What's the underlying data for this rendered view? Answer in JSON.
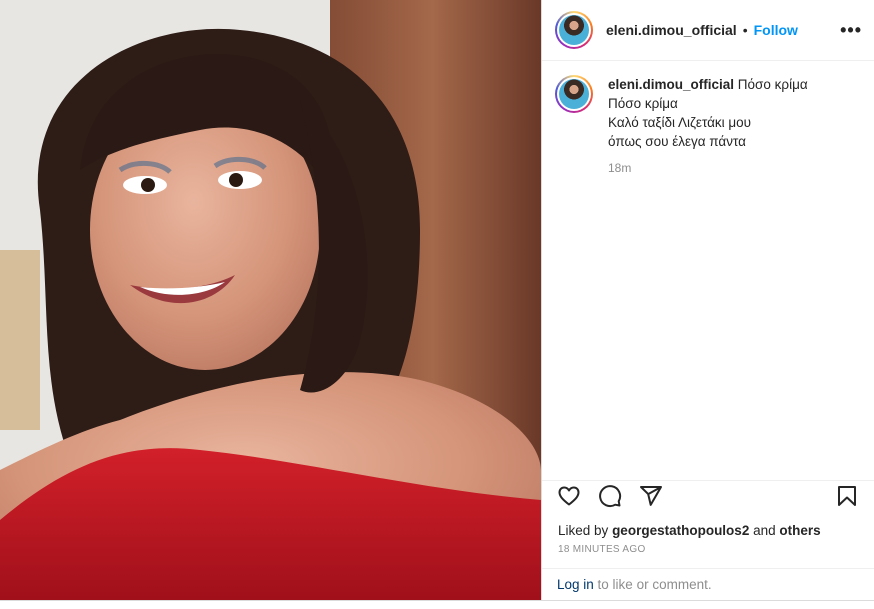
{
  "post": {
    "image_alt": "Portrait of a smiling woman with dark hair wearing a red off-shoulder top"
  },
  "header": {
    "username": "eleni.dimou_official",
    "separator": "•",
    "follow_label": "Follow",
    "more_icon": "more-options-icon",
    "more_label": "•••"
  },
  "caption": {
    "username": "eleni.dimou_official",
    "lines": [
      "Πόσο κρίμα",
      "Πόσο κρίμα",
      "Καλό ταξίδι Λιζετάκι μου",
      "όπως σου έλεγα πάντα"
    ],
    "time": "18m"
  },
  "actions": {
    "like_icon": "heart-icon",
    "comment_icon": "comment-icon",
    "share_icon": "share-icon",
    "save_icon": "bookmark-icon"
  },
  "likes": {
    "prefix": "Liked by",
    "user": "georgestathopoulos2",
    "and": "and",
    "others": "others"
  },
  "timestamp": "18 MINUTES AGO",
  "login_prompt": {
    "link": "Log in",
    "rest": " to like or comment."
  },
  "colors": {
    "accent": "#0095f6",
    "text": "#262626",
    "muted": "#8e8e8e",
    "link": "#00376b"
  }
}
